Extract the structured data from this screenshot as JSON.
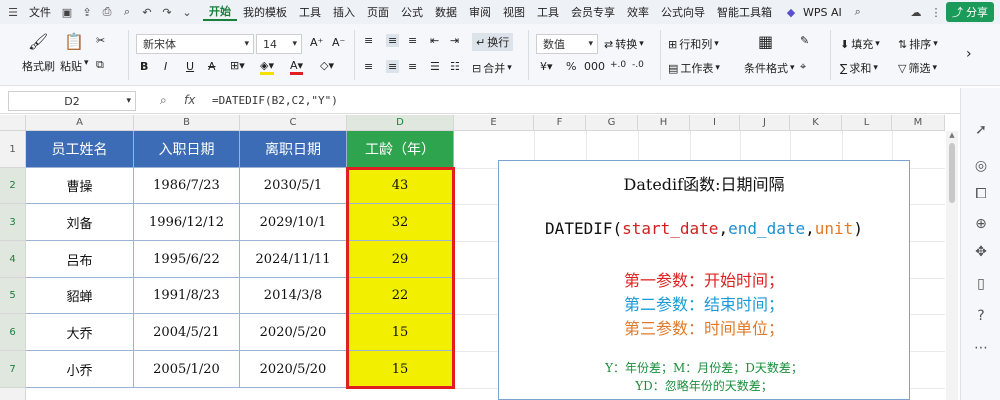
{
  "menubar": {
    "file": "文件",
    "tabs": [
      "开始",
      "我的模板",
      "工具",
      "插入",
      "页面",
      "公式",
      "数据",
      "审阅",
      "视图",
      "工具",
      "会员专享",
      "效率",
      "公式向导",
      "智能工具箱"
    ],
    "ai": "WPS AI",
    "share": "分享"
  },
  "ribbon": {
    "format_painter": "格式刷",
    "paste": "粘贴",
    "font_name": "新宋体",
    "font_size": "14",
    "wrap": "换行",
    "merge": "合并",
    "number_format": "数值",
    "convert": "转换",
    "row_col": "行和列",
    "worksheet": "工作表",
    "cond_format": "条件格式",
    "fill": "填充",
    "sort": "排序",
    "sum": "求和",
    "filter": "筛选"
  },
  "formula_bar": {
    "cell_ref": "D2",
    "fx": "fx",
    "formula": "=DATEDIF(B2,C2,\"Y\")"
  },
  "columns": [
    "A",
    "B",
    "C",
    "D",
    "E",
    "F",
    "G",
    "H",
    "I",
    "J",
    "K",
    "L",
    "M"
  ],
  "rows": [
    "1",
    "2",
    "3",
    "4",
    "5",
    "6",
    "7"
  ],
  "table": {
    "headers": [
      "员工姓名",
      "入职日期",
      "离职日期",
      "工龄（年）"
    ],
    "rows": [
      [
        "曹操",
        "1986/7/23",
        "2030/5/1",
        "43"
      ],
      [
        "刘备",
        "1996/12/12",
        "2029/10/1",
        "32"
      ],
      [
        "吕布",
        "1995/6/22",
        "2024/11/11",
        "29"
      ],
      [
        "貂蝉",
        "1991/8/23",
        "2014/3/8",
        "22"
      ],
      [
        "大乔",
        "2004/5/21",
        "2020/5/20",
        "15"
      ],
      [
        "小乔",
        "2005/1/20",
        "2020/5/20",
        "15"
      ]
    ]
  },
  "textbox": {
    "title": "Datedif函数:日期间隔",
    "syntax_fn": "DATEDIF(",
    "syntax_p1": "start_date",
    "syntax_p2": "end_date",
    "syntax_p3": "unit",
    "syntax_close": ")",
    "line1": "第一参数：开始时间；",
    "line2": "第二参数：结束时间；",
    "line3": "第三参数：时间单位；",
    "note1": "Y：年份差；M：月份差；D天数差；",
    "note2": "YD：忽略年份的天数差；"
  },
  "colors": {
    "header_blue": "#3b6cb5",
    "header_green": "#2ea44f",
    "highlight_yellow": "#f2ef00",
    "selection_red": "#e02020"
  }
}
